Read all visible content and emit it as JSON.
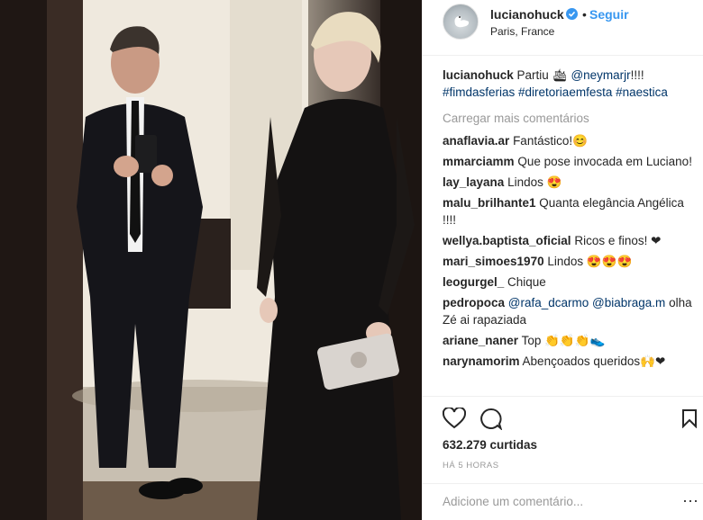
{
  "header": {
    "username": "lucianohuck",
    "separator": "•",
    "follow_label": "Seguir",
    "location": "Paris, France"
  },
  "caption": {
    "username": "lucianohuck",
    "text": "Partiu 🛳",
    "mention": "@neymarjr",
    "after_mention": "!!!!",
    "hashtags": "#fimdasferias #diretoriaemfesta #naestica"
  },
  "load_more_label": "Carregar mais comentários",
  "comments": [
    {
      "user": "anaflavia.ar",
      "text": "Fantástico!😊"
    },
    {
      "user": "mmarciamm",
      "text": "Que pose invocada em Luciano!"
    },
    {
      "user": "lay_layana",
      "text": "Lindos 😍"
    },
    {
      "user": "malu_brilhante1",
      "text": "Quanta elegância Angélica !!!!"
    },
    {
      "user": "wellya.baptista_oficial",
      "text": "Ricos e finos! ❤"
    },
    {
      "user": "mari_simoes1970",
      "text": "Lindos 😍😍😍"
    },
    {
      "user": "leogurgel_",
      "text": "Chique"
    },
    {
      "user": "pedropoca",
      "mention1": "@rafa_dcarmo",
      "mention2": "@biabraga.m",
      "text": "olha Zé ai rapaziada"
    },
    {
      "user": "ariane_naner",
      "text": "Top 👏👏👏👟"
    },
    {
      "user": "narynamorim",
      "text": "Abençoados queridos🙌❤"
    }
  ],
  "actions": {
    "icons": [
      "heart-icon",
      "comment-icon",
      "bookmark-icon"
    ],
    "likes": "632.279 curtidas",
    "time": "HÁ 5 HORAS",
    "add_comment_placeholder": "Adicione um comentário...",
    "more_label": "···"
  },
  "colors": {
    "link": "#003569",
    "follow": "#3897f0",
    "muted": "#999999",
    "border": "#efefef"
  }
}
